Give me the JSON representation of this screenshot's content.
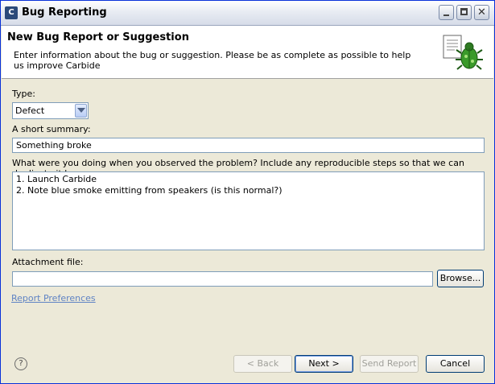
{
  "window": {
    "title": "Bug Reporting",
    "icon": "carbide-app-icon"
  },
  "header": {
    "title": "New Bug Report or Suggestion",
    "description": "Enter information about the bug or suggestion. Please be as complete as possible to help us improve Carbide",
    "icon": "bug-report-icon"
  },
  "form": {
    "type_label": "Type:",
    "type_value": "Defect",
    "summary_label": "A short summary:",
    "summary_value": "Something broke",
    "steps_label": "What were you doing when you observed the problem? Include any reproducible steps so that we can duplicate it here.",
    "steps_lines": [
      "1. Launch Carbide",
      "2. Note blue smoke emitting from speakers (is this normal?)"
    ],
    "attachment_label": "Attachment file:",
    "attachment_value": "",
    "browse_label": "Browse...",
    "preferences_link": "Report Preferences"
  },
  "footer": {
    "help_glyph": "?",
    "back_label": "< Back",
    "next_label": "Next >",
    "send_label": "Send Report",
    "cancel_label": "Cancel"
  },
  "colors": {
    "link": "#5f83c4",
    "title_bar": "#e8ecf3",
    "dialog_bg": "#ece9d8"
  }
}
